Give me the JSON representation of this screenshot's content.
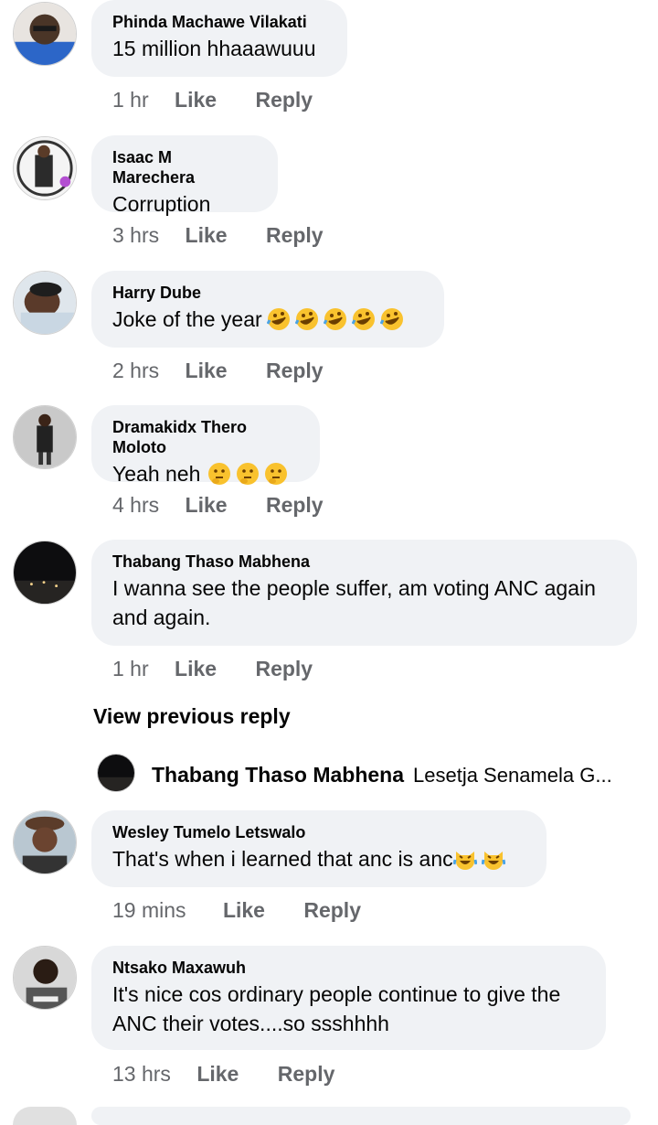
{
  "comments": [
    {
      "name": "Phinda Machawe Vilakati",
      "text": "15 million hhaaawuuu",
      "time": "1 hr",
      "like": "Like",
      "reply": "Reply",
      "emoji": []
    },
    {
      "name": "Isaac M Marechera",
      "text": "Corruption",
      "time": "3 hrs",
      "like": "Like",
      "reply": "Reply",
      "emoji": []
    },
    {
      "name": "Harry Dube",
      "text": "Joke of the year",
      "time": "2 hrs",
      "like": "Like",
      "reply": "Reply",
      "emoji": [
        "rofl",
        "rofl",
        "rofl",
        "rofl",
        "rofl"
      ]
    },
    {
      "name": "Dramakidx Thero Moloto",
      "text": "Yeah neh",
      "time": "4 hrs",
      "like": "Like",
      "reply": "Reply",
      "emoji": [
        "thinking",
        "thinking",
        "thinking"
      ]
    },
    {
      "name": "Thabang Thaso Mabhena",
      "text": "I wanna see the people suffer, am voting ANC again and again.",
      "time": "1 hr",
      "like": "Like",
      "reply": "Reply",
      "emoji": []
    },
    {
      "name": "Wesley Tumelo Letswalo",
      "text": "That's when i learned that anc is anc",
      "time": "19 mins",
      "like": "Like",
      "reply": "Reply",
      "emoji": [
        "joy-cat",
        "joy-cat"
      ]
    },
    {
      "name": "Ntsako Maxawuh",
      "text": "It's nice cos ordinary people continue to give the ANC their votes....so ssshhhh",
      "time": "13 hrs",
      "like": "Like",
      "reply": "Reply",
      "emoji": []
    }
  ],
  "view_previous_reply": "View previous reply",
  "reply_preview": {
    "name": "Thabang Thaso Mabhena",
    "text": "Lesetja Senamela G..."
  },
  "colors": {
    "bubble": "#f0f2f5",
    "meta": "#65676b",
    "text": "#050505"
  }
}
